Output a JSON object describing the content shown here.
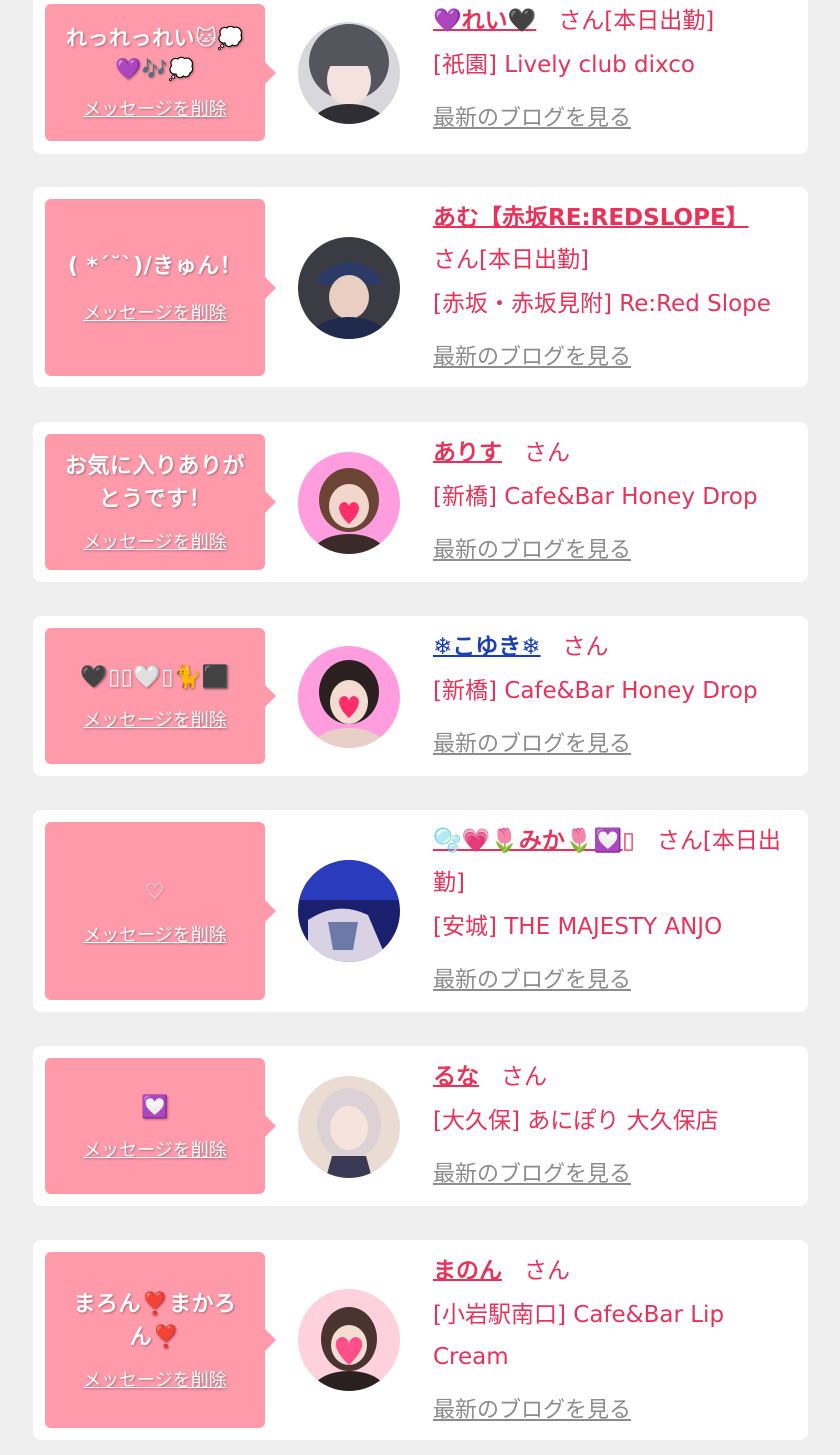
{
  "items": [
    {
      "message": "れっれっれい🐱💭💜🎶💭",
      "delete_label": "メッセージを削除",
      "name": "💜れい🖤",
      "suffix": "さん[本日出勤]",
      "shop": "[祇園] Lively club dixco",
      "blog_label": "最新のブログを見る",
      "avatar_colors": [
        "#c9c9cf",
        "#3a3a40"
      ]
    },
    {
      "message": "( *´˘`)/きゅん！",
      "delete_label": "メッセージを削除",
      "name": "あむ【赤坂RE:REDSLOPE】",
      "suffix": "さん[本日出勤]",
      "shop": "[赤坂・赤坂見附] Re:Red Slope",
      "blog_label": "最新のブログを見る",
      "avatar_colors": [
        "#2b3a66",
        "#d8b8a8"
      ]
    },
    {
      "message": "お気に入りありがとうです！",
      "delete_label": "メッセージを削除",
      "name": "ありす",
      "suffix": "さん",
      "shop": "[新橋] Cafe&Bar Honey Drop",
      "blog_label": "最新のブログを見る",
      "avatar_colors": [
        "#ff8fd8",
        "#5a3a30"
      ]
    },
    {
      "message": "🖤▯▯🤍▯🐈⬛",
      "delete_label": "メッセージを削除",
      "name": "❄こゆき❄",
      "suffix": "さん",
      "shop": "[新橋] Cafe&Bar Honey Drop",
      "blog_label": "最新のブログを見る",
      "avatar_colors": [
        "#ff8fd8",
        "#2a2020"
      ]
    },
    {
      "message": "♡",
      "delete_label": "メッセージを削除",
      "name": "🫧💗🌷みか🌷💟▯",
      "suffix": "さん[本日出勤]",
      "shop": "[安城] THE MAJESTY ANJO",
      "blog_label": "最新のブログを見る",
      "avatar_colors": [
        "#1a1f6e",
        "#c9c2d6"
      ]
    },
    {
      "message": "💟",
      "delete_label": "メッセージを削除",
      "name": "るな",
      "suffix": "さん",
      "shop": "[大久保] あにぽり 大久保店",
      "blog_label": "最新のブログを見る",
      "avatar_colors": [
        "#e9dcd2",
        "#8a7a80"
      ]
    },
    {
      "message": "まろん❣️まかろん❣️",
      "delete_label": "メッセージを削除",
      "name": "まのん",
      "suffix": "さん",
      "shop": "[小岩駅南口] Cafe&Bar Lip Cream",
      "blog_label": "最新のブログを見る",
      "avatar_colors": [
        "#ffc3d6",
        "#3a2a28"
      ]
    }
  ]
}
